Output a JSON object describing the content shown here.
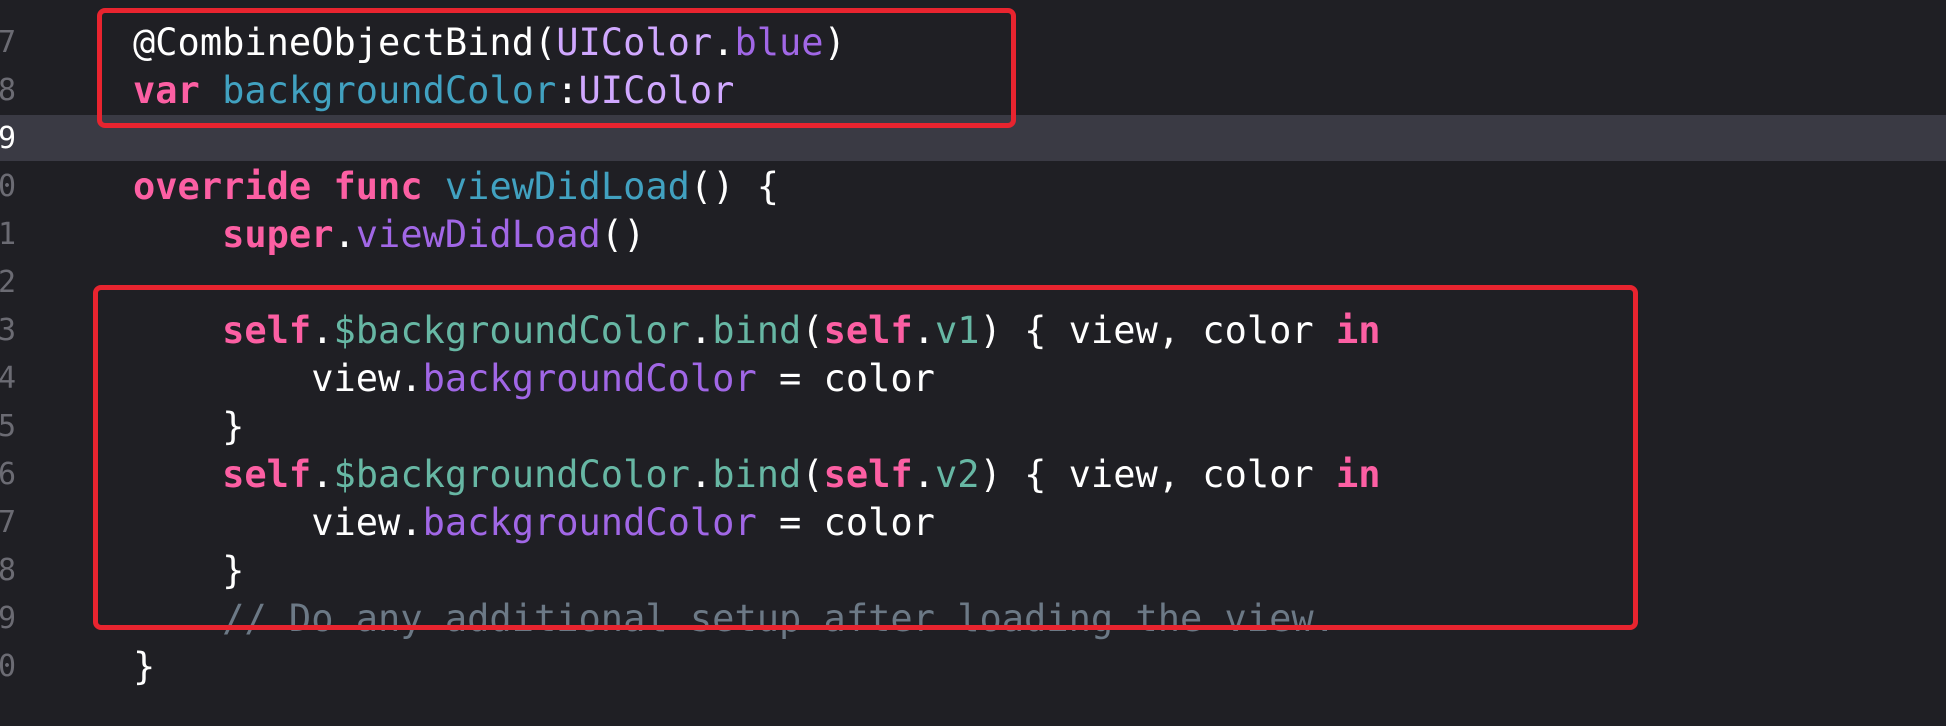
{
  "editor": {
    "line_numbers": [
      "7",
      "8",
      "9",
      "0",
      "1",
      "2",
      "3",
      "4",
      "5",
      "6",
      "7",
      "8",
      "9",
      "0"
    ],
    "active_line_number": "9",
    "lines": [
      [
        {
          "t": "@CombineObjectBind(",
          "c": "plain"
        },
        {
          "t": "UIColor",
          "c": "type"
        },
        {
          "t": ".",
          "c": "plain"
        },
        {
          "t": "blue",
          "c": "member"
        },
        {
          "t": ")",
          "c": "plain"
        }
      ],
      [
        {
          "t": "var",
          "c": "keyword"
        },
        {
          "t": " ",
          "c": "plain"
        },
        {
          "t": "backgroundColor",
          "c": "decl"
        },
        {
          "t": ":",
          "c": "plain"
        },
        {
          "t": "UIColor",
          "c": "type"
        }
      ],
      [],
      [
        {
          "t": "override",
          "c": "keyword"
        },
        {
          "t": " ",
          "c": "plain"
        },
        {
          "t": "func",
          "c": "keyword"
        },
        {
          "t": " ",
          "c": "plain"
        },
        {
          "t": "viewDidLoad",
          "c": "decl"
        },
        {
          "t": "() {",
          "c": "plain"
        }
      ],
      [
        {
          "t": "    ",
          "c": "plain"
        },
        {
          "t": "super",
          "c": "keyword"
        },
        {
          "t": ".",
          "c": "plain"
        },
        {
          "t": "viewDidLoad",
          "c": "member"
        },
        {
          "t": "()",
          "c": "plain"
        }
      ],
      [],
      [
        {
          "t": "    ",
          "c": "plain"
        },
        {
          "t": "self",
          "c": "keyword"
        },
        {
          "t": ".",
          "c": "plain"
        },
        {
          "t": "$backgroundColor",
          "c": "project"
        },
        {
          "t": ".",
          "c": "plain"
        },
        {
          "t": "bind",
          "c": "project"
        },
        {
          "t": "(",
          "c": "plain"
        },
        {
          "t": "self",
          "c": "keyword"
        },
        {
          "t": ".",
          "c": "plain"
        },
        {
          "t": "v1",
          "c": "project"
        },
        {
          "t": ") { view, color ",
          "c": "plain"
        },
        {
          "t": "in",
          "c": "keyword"
        }
      ],
      [
        {
          "t": "        view.",
          "c": "plain"
        },
        {
          "t": "backgroundColor",
          "c": "member"
        },
        {
          "t": " = color",
          "c": "plain"
        }
      ],
      [
        {
          "t": "    }",
          "c": "plain"
        }
      ],
      [
        {
          "t": "    ",
          "c": "plain"
        },
        {
          "t": "self",
          "c": "keyword"
        },
        {
          "t": ".",
          "c": "plain"
        },
        {
          "t": "$backgroundColor",
          "c": "project"
        },
        {
          "t": ".",
          "c": "plain"
        },
        {
          "t": "bind",
          "c": "project"
        },
        {
          "t": "(",
          "c": "plain"
        },
        {
          "t": "self",
          "c": "keyword"
        },
        {
          "t": ".",
          "c": "plain"
        },
        {
          "t": "v2",
          "c": "project"
        },
        {
          "t": ") { view, color ",
          "c": "plain"
        },
        {
          "t": "in",
          "c": "keyword"
        }
      ],
      [
        {
          "t": "        view.",
          "c": "plain"
        },
        {
          "t": "backgroundColor",
          "c": "member"
        },
        {
          "t": " = color",
          "c": "plain"
        }
      ],
      [
        {
          "t": "    }",
          "c": "plain"
        }
      ],
      [
        {
          "t": "    // Do any additional setup after loading the view.",
          "c": "comment"
        }
      ],
      [
        {
          "t": "}",
          "c": "plain"
        }
      ]
    ]
  },
  "colors": {
    "background": "#1f1f24",
    "current_line": "#3a3a44",
    "keyword": "#fc5fa3",
    "declaration": "#41a1c0",
    "type": "#d0a8ff",
    "member": "#a167e6",
    "project": "#67b7a4",
    "comment": "#6c7986",
    "highlight_box": "#e8242f"
  }
}
